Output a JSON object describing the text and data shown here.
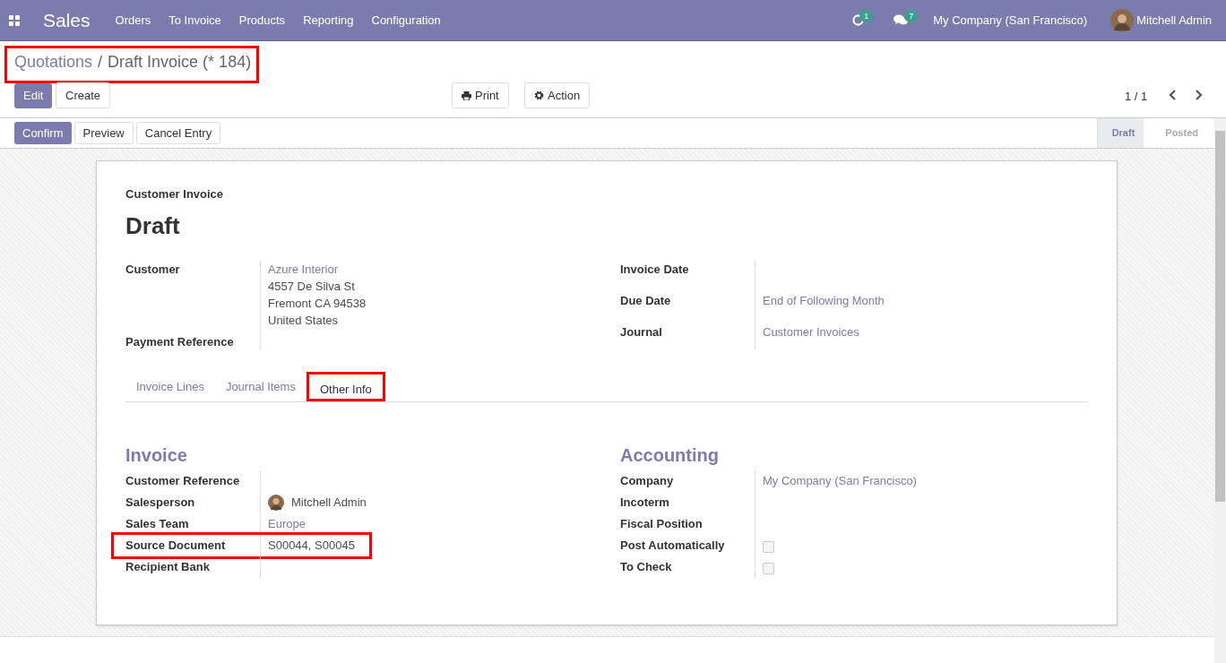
{
  "navbar": {
    "app": "Sales",
    "menu": [
      "Orders",
      "To Invoice",
      "Products",
      "Reporting",
      "Configuration"
    ],
    "activity_count": "1",
    "message_count": "7",
    "company": "My Company (San Francisco)",
    "user": "Mitchell Admin"
  },
  "breadcrumb": {
    "parent": "Quotations",
    "separator": "/",
    "current": "Draft Invoice (* 184)",
    "highlighted": true
  },
  "buttons": {
    "edit": "Edit",
    "create": "Create",
    "print": "Print",
    "action": "Action"
  },
  "pager": "1 / 1",
  "header_buttons": [
    {
      "label": "Confirm",
      "primary": true
    },
    {
      "label": "Preview",
      "primary": false
    },
    {
      "label": "Cancel Entry",
      "primary": false
    }
  ],
  "status_steps": [
    {
      "label": "Draft",
      "selected": true
    },
    {
      "label": "Posted",
      "selected": false
    }
  ],
  "sheet": {
    "type_label": "Customer Invoice",
    "title": "Draft",
    "left_fields": [
      {
        "label": "Customer",
        "lines": [
          "Azure Interior",
          "4557 De Silva St",
          "Fremont CA 94538",
          "United States"
        ],
        "link": true
      },
      {
        "label": "Payment Reference"
      }
    ],
    "right_fields": [
      {
        "label": "Invoice Date"
      },
      {
        "label": "Due Date",
        "lines": [
          "End of Following Month"
        ],
        "link": true
      },
      {
        "label": "Journal",
        "lines": [
          "Customer Invoices"
        ],
        "link": true
      }
    ],
    "tabs": [
      {
        "label": "Invoice Lines",
        "selected": false,
        "highlighted": false
      },
      {
        "label": "Journal Items",
        "selected": false,
        "highlighted": false
      },
      {
        "label": "Other Info",
        "selected": true,
        "highlighted": true
      }
    ],
    "groups": [
      {
        "title": "Invoice",
        "fields": [
          {
            "label": "Customer Reference",
            "kind": "text",
            "highlighted": false
          },
          {
            "label": "Salesperson",
            "kind": "user",
            "value": "Mitchell Admin",
            "highlighted": false
          },
          {
            "label": "Sales Team",
            "kind": "link",
            "value": "Europe",
            "highlighted": false
          },
          {
            "label": "Source Document",
            "kind": "text",
            "value": "S00044, S00045",
            "highlighted": true
          },
          {
            "label": "Recipient Bank",
            "kind": "text",
            "highlighted": false
          }
        ]
      },
      {
        "title": "Accounting",
        "fields": [
          {
            "label": "Company",
            "kind": "link",
            "value": "My Company (San Francisco)",
            "highlighted": false
          },
          {
            "label": "Incoterm",
            "kind": "text",
            "highlighted": false
          },
          {
            "label": "Fiscal Position",
            "kind": "text",
            "highlighted": false
          },
          {
            "label": "Post Automatically",
            "kind": "checkbox",
            "checked": false,
            "highlighted": false
          },
          {
            "label": "To Check",
            "kind": "checkbox",
            "checked": false,
            "highlighted": false
          }
        ]
      }
    ]
  }
}
